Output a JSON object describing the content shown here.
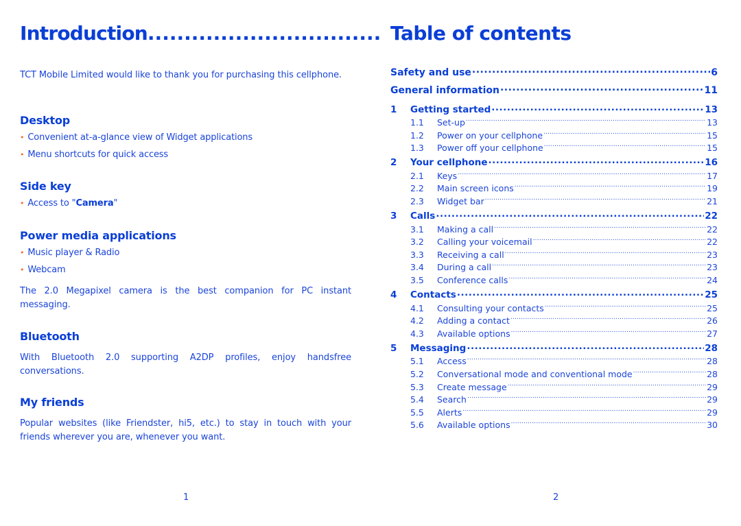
{
  "left_page": {
    "title": "Introduction",
    "title_leader": "................................",
    "intro": "TCT Mobile Limited would like to thank you for purchasing this cellphone.",
    "sections": [
      {
        "heading": "Desktop",
        "bullets": [
          "Convenient at-a-glance view of Widget applications",
          "Menu shortcuts for quick access"
        ]
      },
      {
        "heading": "Side key",
        "bullet_prefix": "Access to \"",
        "bullet_bold": "Camera",
        "bullet_suffix": "\""
      },
      {
        "heading": "Power media applications",
        "bullets": [
          "Music player & Radio",
          "Webcam"
        ],
        "paragraph": "The 2.0 Megapixel camera is the best companion for PC instant messaging."
      },
      {
        "heading": "Bluetooth",
        "paragraph": "With Bluetooth 2.0 supporting A2DP profiles, enjoy handsfree conversations."
      },
      {
        "heading": "My friends",
        "paragraph": "Popular websites (like Friendster, hi5, etc.) to stay in touch with your friends wherever you are, whenever you want."
      }
    ],
    "bullet_glyph": "•",
    "page_number": "1"
  },
  "right_page": {
    "title": "Table of contents",
    "toc": [
      {
        "level": "top",
        "num": "",
        "title": "Safety and use",
        "page": "6"
      },
      {
        "level": "top",
        "num": "",
        "title": "General information",
        "page": "11"
      },
      {
        "level": "chap",
        "num": "1",
        "title": "Getting started",
        "page": "13"
      },
      {
        "level": "sub",
        "num": "1.1",
        "title": "Set-up",
        "page": "13"
      },
      {
        "level": "sub",
        "num": "1.2",
        "title": "Power on your cellphone",
        "page": "15"
      },
      {
        "level": "sub",
        "num": "1.3",
        "title": "Power off your cellphone",
        "page": "15"
      },
      {
        "level": "chap",
        "num": "2",
        "title": "Your cellphone",
        "page": "16"
      },
      {
        "level": "sub",
        "num": "2.1",
        "title": "Keys",
        "page": "17"
      },
      {
        "level": "sub",
        "num": "2.2",
        "title": "Main screen icons",
        "page": "19"
      },
      {
        "level": "sub",
        "num": "2.3",
        "title": "Widget bar",
        "page": "21"
      },
      {
        "level": "chap",
        "num": "3",
        "title": "Calls",
        "page": "22"
      },
      {
        "level": "sub",
        "num": "3.1",
        "title": "Making a call",
        "page": "22"
      },
      {
        "level": "sub",
        "num": "3.2",
        "title": "Calling your voicemail",
        "page": "22"
      },
      {
        "level": "sub",
        "num": "3.3",
        "title": "Receiving a call",
        "page": "23"
      },
      {
        "level": "sub",
        "num": "3.4",
        "title": "During a call",
        "page": "23"
      },
      {
        "level": "sub",
        "num": "3.5",
        "title": "Conference calls",
        "page": "24"
      },
      {
        "level": "chap",
        "num": "4",
        "title": "Contacts",
        "page": "25"
      },
      {
        "level": "sub",
        "num": "4.1",
        "title": "Consulting your contacts",
        "page": "25"
      },
      {
        "level": "sub",
        "num": "4.2",
        "title": "Adding a contact",
        "page": "26"
      },
      {
        "level": "sub",
        "num": "4.3",
        "title": "Available options",
        "page": "27"
      },
      {
        "level": "chap",
        "num": "5",
        "title": "Messaging",
        "page": "28"
      },
      {
        "level": "sub",
        "num": "5.1",
        "title": "Access",
        "page": "28"
      },
      {
        "level": "sub",
        "num": "5.2",
        "title": "Conversational mode and conventional mode",
        "page": "28"
      },
      {
        "level": "sub",
        "num": "5.3",
        "title": "Create message",
        "page": "29"
      },
      {
        "level": "sub",
        "num": "5.4",
        "title": "Search",
        "page": "29"
      },
      {
        "level": "sub",
        "num": "5.5",
        "title": "Alerts",
        "page": "29"
      },
      {
        "level": "sub",
        "num": "5.6",
        "title": "Available options",
        "page": "30"
      }
    ],
    "page_number": "2"
  },
  "colors": {
    "text_blue": "#1a44d8",
    "heading_blue": "#0a3fd6",
    "bullet_orange": "#f26a30",
    "background": "#ffffff"
  }
}
